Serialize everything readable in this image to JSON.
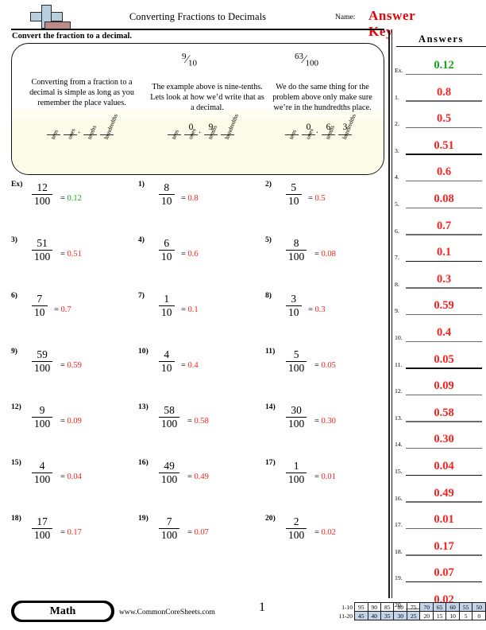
{
  "header": {
    "title": "Converting Fractions to Decimals",
    "name_label": "Name:",
    "name_value": "Answer Key",
    "instruction": "Convert the fraction to a decimal.",
    "answer_key_color": "#e8000b"
  },
  "info_box": {
    "fraction1": {
      "numerator": "9",
      "slash": "⁄",
      "denominator": "10"
    },
    "fraction2": {
      "numerator": "63",
      "slash": "⁄",
      "denominator": "100"
    },
    "col1_text": "Converting from a fraction to a decimal is simple as long as you remember the place values.",
    "col2_text": "The example above is nine-tenths. Lets look at how we’d write that as a decimal.",
    "col3_text": "We do the same thing for the problem above only make sure we’re in the hundredths place.",
    "place_labels": [
      "tens",
      "ones",
      "tenths",
      "hundredths"
    ],
    "chart1_digits": [
      "",
      "",
      "",
      ""
    ],
    "chart2_digits": [
      "",
      "0",
      "9",
      ""
    ],
    "chart3_digits": [
      "",
      "0",
      "6",
      "3"
    ],
    "decimal_point": "."
  },
  "problems": [
    {
      "label": "Ex)",
      "numerator": "12",
      "denominator": "100",
      "equals": "=",
      "answer": "0.12",
      "color": "green"
    },
    {
      "label": "1)",
      "numerator": "8",
      "denominator": "10",
      "equals": "=",
      "answer": "0.8",
      "color": "red"
    },
    {
      "label": "2)",
      "numerator": "5",
      "denominator": "10",
      "equals": "=",
      "answer": "0.5",
      "color": "red"
    },
    {
      "label": "3)",
      "numerator": "51",
      "denominator": "100",
      "equals": "=",
      "answer": "0.51",
      "color": "red"
    },
    {
      "label": "4)",
      "numerator": "6",
      "denominator": "10",
      "equals": "=",
      "answer": "0.6",
      "color": "red"
    },
    {
      "label": "5)",
      "numerator": "8",
      "denominator": "100",
      "equals": "=",
      "answer": "0.08",
      "color": "red"
    },
    {
      "label": "6)",
      "numerator": "7",
      "denominator": "10",
      "equals": "=",
      "answer": "0.7",
      "color": "red"
    },
    {
      "label": "7)",
      "numerator": "1",
      "denominator": "10",
      "equals": "=",
      "answer": "0.1",
      "color": "red"
    },
    {
      "label": "8)",
      "numerator": "3",
      "denominator": "10",
      "equals": "=",
      "answer": "0.3",
      "color": "red"
    },
    {
      "label": "9)",
      "numerator": "59",
      "denominator": "100",
      "equals": "=",
      "answer": "0.59",
      "color": "red"
    },
    {
      "label": "10)",
      "numerator": "4",
      "denominator": "10",
      "equals": "=",
      "answer": "0.4",
      "color": "red"
    },
    {
      "label": "11)",
      "numerator": "5",
      "denominator": "100",
      "equals": "=",
      "answer": "0.05",
      "color": "red"
    },
    {
      "label": "12)",
      "numerator": "9",
      "denominator": "100",
      "equals": "=",
      "answer": "0.09",
      "color": "red"
    },
    {
      "label": "13)",
      "numerator": "58",
      "denominator": "100",
      "equals": "=",
      "answer": "0.58",
      "color": "red"
    },
    {
      "label": "14)",
      "numerator": "30",
      "denominator": "100",
      "equals": "=",
      "answer": "0.30",
      "color": "red"
    },
    {
      "label": "15)",
      "numerator": "4",
      "denominator": "100",
      "equals": "=",
      "answer": "0.04",
      "color": "red"
    },
    {
      "label": "16)",
      "numerator": "49",
      "denominator": "100",
      "equals": "=",
      "answer": "0.49",
      "color": "red"
    },
    {
      "label": "17)",
      "numerator": "1",
      "denominator": "100",
      "equals": "=",
      "answer": "0.01",
      "color": "red"
    },
    {
      "label": "18)",
      "numerator": "17",
      "denominator": "100",
      "equals": "=",
      "answer": "0.17",
      "color": "red"
    },
    {
      "label": "19)",
      "numerator": "7",
      "denominator": "100",
      "equals": "=",
      "answer": "0.07",
      "color": "red"
    },
    {
      "label": "20)",
      "numerator": "2",
      "denominator": "100",
      "equals": "=",
      "answer": "0.02",
      "color": "red"
    }
  ],
  "answers_panel": {
    "title": "Answers",
    "rows": [
      {
        "num": "Ex.",
        "value": "0.12",
        "color": "green"
      },
      {
        "num": "1.",
        "value": "0.8",
        "color": "red"
      },
      {
        "num": "2.",
        "value": "0.5",
        "color": "red"
      },
      {
        "num": "3.",
        "value": "0.51",
        "color": "red"
      },
      {
        "num": "4.",
        "value": "0.6",
        "color": "red"
      },
      {
        "num": "5.",
        "value": "0.08",
        "color": "red"
      },
      {
        "num": "6.",
        "value": "0.7",
        "color": "red"
      },
      {
        "num": "7.",
        "value": "0.1",
        "color": "red"
      },
      {
        "num": "8.",
        "value": "0.3",
        "color": "red"
      },
      {
        "num": "9.",
        "value": "0.59",
        "color": "red"
      },
      {
        "num": "10.",
        "value": "0.4",
        "color": "red"
      },
      {
        "num": "11.",
        "value": "0.05",
        "color": "red"
      },
      {
        "num": "12.",
        "value": "0.09",
        "color": "red"
      },
      {
        "num": "13.",
        "value": "0.58",
        "color": "red"
      },
      {
        "num": "14.",
        "value": "0.30",
        "color": "red"
      },
      {
        "num": "15.",
        "value": "0.04",
        "color": "red"
      },
      {
        "num": "16.",
        "value": "0.49",
        "color": "red"
      },
      {
        "num": "17.",
        "value": "0.01",
        "color": "red"
      },
      {
        "num": "18.",
        "value": "0.17",
        "color": "red"
      },
      {
        "num": "19.",
        "value": "0.07",
        "color": "red"
      },
      {
        "num": "20.",
        "value": "0.02",
        "color": "red"
      }
    ]
  },
  "footer": {
    "subject_badge": "Math",
    "website": "www.CommonCoreSheets.com",
    "page_number": "1",
    "scale": {
      "row1_label": "1-10",
      "row2_label": "11-20",
      "row1": [
        {
          "v": "95",
          "shaded": false
        },
        {
          "v": "90",
          "shaded": false
        },
        {
          "v": "85",
          "shaded": false
        },
        {
          "v": "80",
          "shaded": false
        },
        {
          "v": "75",
          "shaded": false
        },
        {
          "v": "70",
          "shaded": true
        },
        {
          "v": "65",
          "shaded": true
        },
        {
          "v": "60",
          "shaded": true
        },
        {
          "v": "55",
          "shaded": true
        },
        {
          "v": "50",
          "shaded": true
        }
      ],
      "row2": [
        {
          "v": "45",
          "shaded": true
        },
        {
          "v": "40",
          "shaded": true
        },
        {
          "v": "35",
          "shaded": true
        },
        {
          "v": "30",
          "shaded": true
        },
        {
          "v": "25",
          "shaded": true
        },
        {
          "v": "20",
          "shaded": false
        },
        {
          "v": "15",
          "shaded": false
        },
        {
          "v": "10",
          "shaded": false
        },
        {
          "v": "5",
          "shaded": false
        },
        {
          "v": "0",
          "shaded": false
        }
      ],
      "shade_color": "#c3d3ea"
    }
  }
}
